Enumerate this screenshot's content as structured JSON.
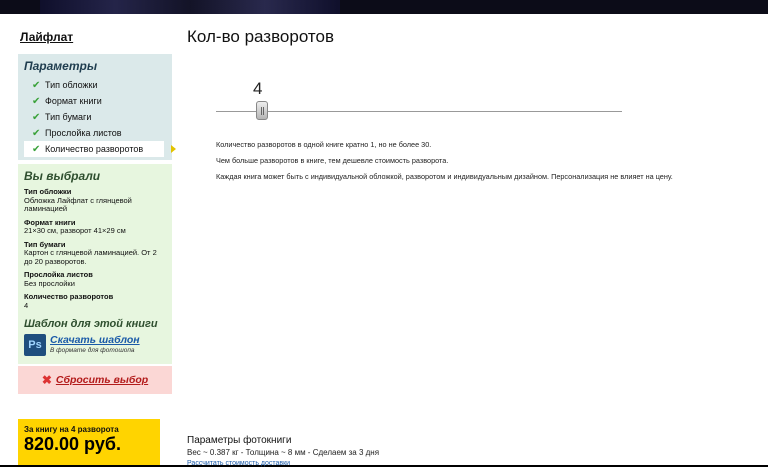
{
  "brand": "Лайфлат",
  "params_panel": {
    "title": "Параметры",
    "steps": [
      {
        "label": "Тип обложки"
      },
      {
        "label": "Формат книги"
      },
      {
        "label": "Тип бумаги"
      },
      {
        "label": "Прослойка листов"
      },
      {
        "label": "Количество разворотов",
        "active": true
      }
    ]
  },
  "chosen_panel": {
    "title": "Вы выбрали",
    "items": [
      {
        "key": "Тип обложки",
        "value": "Обложка Лайфлат с глянцевой ламинацией"
      },
      {
        "key": "Формат книги",
        "value": "21×30 см, разворот 41×29 см"
      },
      {
        "key": "Тип бумаги",
        "value": "Картон с глянцевой ламинацией. От 2 до 20 разворотов."
      },
      {
        "key": "Прослойка листов",
        "value": "Без прослойки"
      },
      {
        "key": "Количество разворотов",
        "value": "4"
      }
    ],
    "template_title": "Шаблон для этой книги",
    "template_icon_text": "Ps",
    "template_link": "Скачать шаблон",
    "template_sub": "В формате для фотошопа"
  },
  "reset_label": "Сбросить выбор",
  "price": {
    "caption": "За книгу на 4 разворота",
    "value": "820.00 руб."
  },
  "main": {
    "title": "Кол-во разворотов",
    "slider_value": "4",
    "info": [
      "Количество разворотов в одной книге кратно 1, но не более 30.",
      "Чем больше разворотов в книге, тем дешевле стоимость разворота.",
      "Каждая книга может быть с индивидуальной обложкой, разворотом и индивидуальным дизайном. Персонализация не влияет на цену."
    ]
  },
  "footer": {
    "title": "Параметры фотокниги",
    "meta": "Вес ~ 0.387 кг - Толщина ~ 8 мм - Сделаем за 3 дня",
    "link": "Рассчитать стоимость доставки"
  },
  "colors": {
    "params_bg": "#dbe9ea",
    "chosen_bg": "#e7f6df",
    "reset_bg": "#fbd7d5",
    "price_bg": "#ffd400",
    "link": "#1a5aa8",
    "check": "#3aa23a"
  },
  "icons": {
    "check": "check-icon",
    "active_arrow": "arrow-right-icon",
    "reset": "close-icon",
    "photoshop": "photoshop-icon"
  }
}
